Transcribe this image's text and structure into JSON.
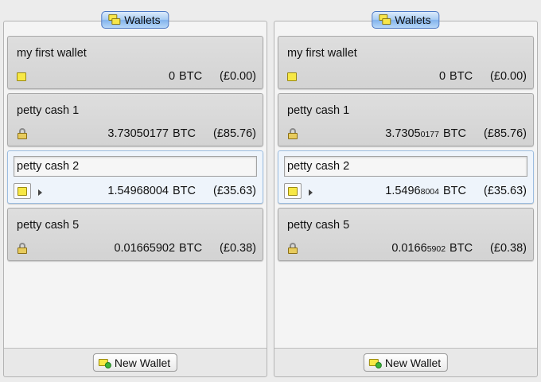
{
  "panels": [
    {
      "title": "Wallets",
      "new_wallet_label": "New Wallet",
      "wallets": [
        {
          "name": "my first wallet",
          "btc_main": "0",
          "btc_small": "",
          "unit": "BTC",
          "fiat": "(£0.00)",
          "icon": "wallet-icon"
        },
        {
          "name": "petty cash 1",
          "btc_main": "3.73050177",
          "btc_small": "",
          "unit": "BTC",
          "fiat": "(£85.76)",
          "icon": "lock-icon"
        },
        {
          "name": "petty cash 2",
          "btc_main": "1.54968004",
          "btc_small": "",
          "unit": "BTC",
          "fiat": "(£35.63)",
          "icon": "wallet-icon"
        },
        {
          "name": "petty cash 5",
          "btc_main": "0.01665902",
          "btc_small": "",
          "unit": "BTC",
          "fiat": "(£0.38)",
          "icon": "lock-icon"
        }
      ]
    },
    {
      "title": "Wallets",
      "new_wallet_label": "New Wallet",
      "wallets": [
        {
          "name": "my first wallet",
          "btc_main": "0",
          "btc_small": "",
          "unit": "BTC",
          "fiat": "(£0.00)",
          "icon": "wallet-icon"
        },
        {
          "name": "petty cash 1",
          "btc_main": "3.7305",
          "btc_small": "0177",
          "unit": "BTC",
          "fiat": "(£85.76)",
          "icon": "lock-icon"
        },
        {
          "name": "petty cash 2",
          "btc_main": "1.5496",
          "btc_small": "8004",
          "unit": "BTC",
          "fiat": "(£35.63)",
          "icon": "wallet-icon"
        },
        {
          "name": "petty cash 5",
          "btc_main": "0.0166",
          "btc_small": "5902",
          "unit": "BTC",
          "fiat": "(£0.38)",
          "icon": "lock-icon"
        }
      ]
    }
  ],
  "selected_wallet_index": 2,
  "colors": {
    "title_pill": "#a9cdf3",
    "selected_border": "#9cbde0",
    "wallet_yellow": "#f7e845"
  }
}
